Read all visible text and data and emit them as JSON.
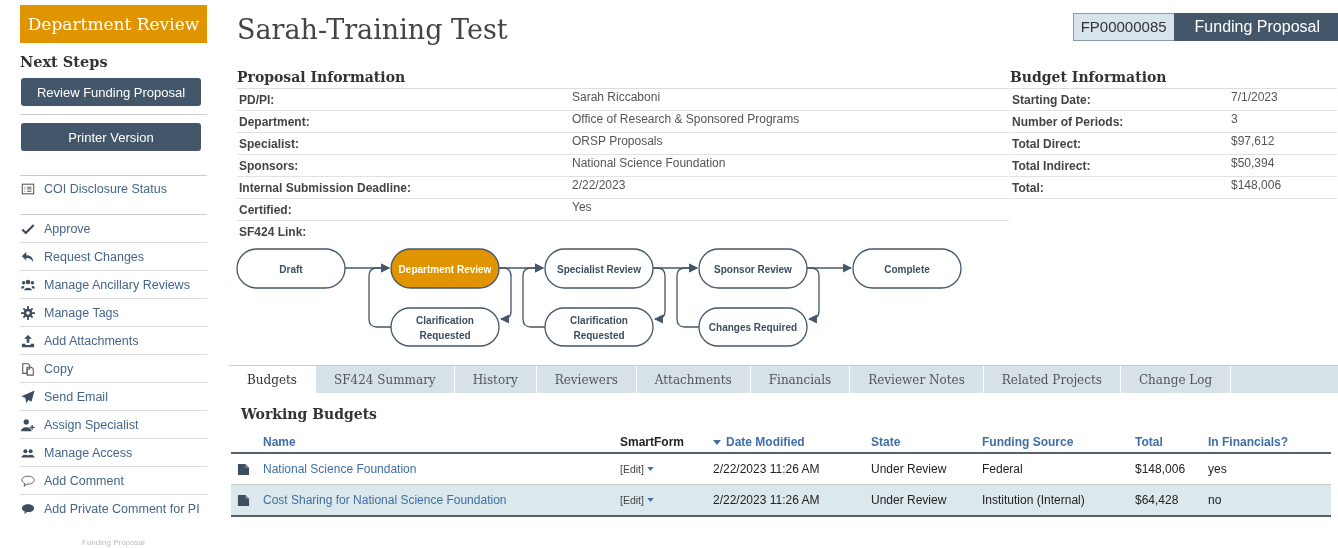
{
  "sidebar": {
    "state_badge": "Department Review",
    "next_steps_title": "Next Steps",
    "buttons": [
      "Review Funding Proposal",
      "Printer Version"
    ],
    "status_link": {
      "kind": "list",
      "label": "COI Disclosure Status"
    },
    "actions": [
      {
        "kind": "check",
        "label": "Approve"
      },
      {
        "kind": "reply",
        "label": "Request Changes"
      },
      {
        "kind": "users",
        "label": "Manage Ancillary Reviews"
      },
      {
        "kind": "gear",
        "label": "Manage Tags"
      },
      {
        "kind": "upload",
        "label": "Add Attachments"
      },
      {
        "kind": "copy",
        "label": "Copy"
      },
      {
        "kind": "send",
        "label": "Send Email"
      },
      {
        "kind": "userplus",
        "label": "Assign Specialist"
      },
      {
        "kind": "people",
        "label": "Manage Access"
      },
      {
        "kind": "comment",
        "label": "Add Comment"
      },
      {
        "kind": "privatecomment",
        "label": "Add Private Comment for PI"
      }
    ],
    "footer": "Funding Proposal"
  },
  "header": {
    "title": "Sarah-Training Test",
    "id": "FP00000085",
    "type": "Funding Proposal"
  },
  "proposal_info": {
    "title": "Proposal Information",
    "rows": [
      {
        "label": "PD/PI:",
        "value": "Sarah Riccaboni"
      },
      {
        "label": "Department:",
        "value": "Office of Research & Sponsored Programs"
      },
      {
        "label": "Specialist:",
        "value": "ORSP Proposals"
      },
      {
        "label": "Sponsors:",
        "value": "National Science Foundation"
      },
      {
        "label": "Internal Submission Deadline:",
        "value": "2/22/2023"
      },
      {
        "label": "Certified:",
        "value": "Yes"
      },
      {
        "label": "SF424 Link:"
      }
    ]
  },
  "budget_info": {
    "title": "Budget Information",
    "rows": [
      {
        "label": "Starting Date:",
        "value": "7/1/2023"
      },
      {
        "label": "Number of Periods:",
        "value": "3"
      },
      {
        "label": "Total Direct:",
        "value": "$97,612"
      },
      {
        "label": "Total Indirect:",
        "value": "$50,394"
      },
      {
        "label": "Total:",
        "value": "$148,006"
      }
    ]
  },
  "workflow": {
    "steps": [
      {
        "label": "Draft",
        "current": false
      },
      {
        "label": "Department Review",
        "current": true,
        "branch": {
          "label": "Clarification Requested"
        }
      },
      {
        "label": "Specialist Review",
        "current": false,
        "branch": {
          "label": "Clarification Requested"
        }
      },
      {
        "label": "Sponsor Review",
        "current": false,
        "branch": {
          "label": "Changes Required"
        }
      },
      {
        "label": "Complete",
        "current": false
      }
    ]
  },
  "tabs": [
    {
      "label": "Budgets",
      "selected": true
    },
    {
      "label": "SF424 Summary",
      "selected": false
    },
    {
      "label": "History",
      "selected": false
    },
    {
      "label": "Reviewers",
      "selected": false
    },
    {
      "label": "Attachments",
      "selected": false
    },
    {
      "label": "Financials",
      "selected": false
    },
    {
      "label": "Reviewer Notes",
      "selected": false
    },
    {
      "label": "Related Projects",
      "selected": false
    },
    {
      "label": "Change Log",
      "selected": false
    }
  ],
  "working_budgets": {
    "title": "Working Budgets",
    "columns": [
      {
        "label": "Name",
        "sortable": true,
        "sorted": false
      },
      {
        "label": "SmartForm",
        "sortable": false,
        "sorted": false
      },
      {
        "label": "Date Modified",
        "sortable": true,
        "sorted": true
      },
      {
        "label": "State",
        "sortable": true,
        "sorted": false
      },
      {
        "label": "Funding Source",
        "sortable": true,
        "sorted": false
      },
      {
        "label": "Total",
        "sortable": true,
        "sorted": false
      },
      {
        "label": "In Financials?",
        "sortable": true,
        "sorted": false
      }
    ],
    "rows": [
      {
        "selected": false,
        "name": "National Science Foundation",
        "smartform": "[Edit]",
        "date": "2/22/2023 11:26 AM",
        "state": "Under Review",
        "source": "Federal",
        "total": "$148,006",
        "in_financials": "yes"
      },
      {
        "selected": true,
        "name": "Cost Sharing for National Science Foundation",
        "smartform": "[Edit]",
        "date": "2/22/2023 11:26 AM",
        "state": "Under Review",
        "source": "Institution (Internal)",
        "total": "$64,428",
        "in_financials": "no"
      }
    ]
  }
}
